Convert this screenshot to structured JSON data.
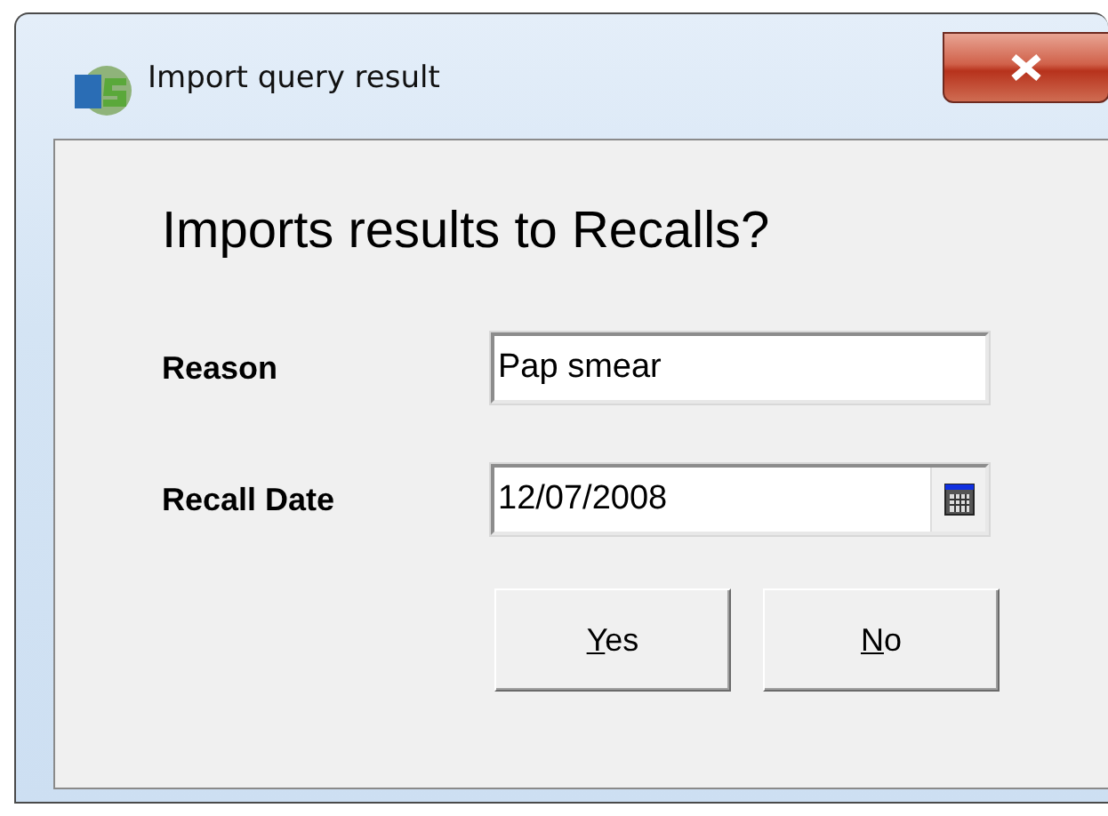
{
  "window": {
    "title": "Import query result"
  },
  "heading": "Imports results to Recalls?",
  "fields": [
    {
      "kind": "text",
      "label": "Reason",
      "value": "Pap smear"
    },
    {
      "kind": "date",
      "label": "Recall Date",
      "value": "12/07/2008"
    }
  ],
  "buttons": [
    {
      "label": "Yes"
    },
    {
      "label": "No"
    }
  ]
}
